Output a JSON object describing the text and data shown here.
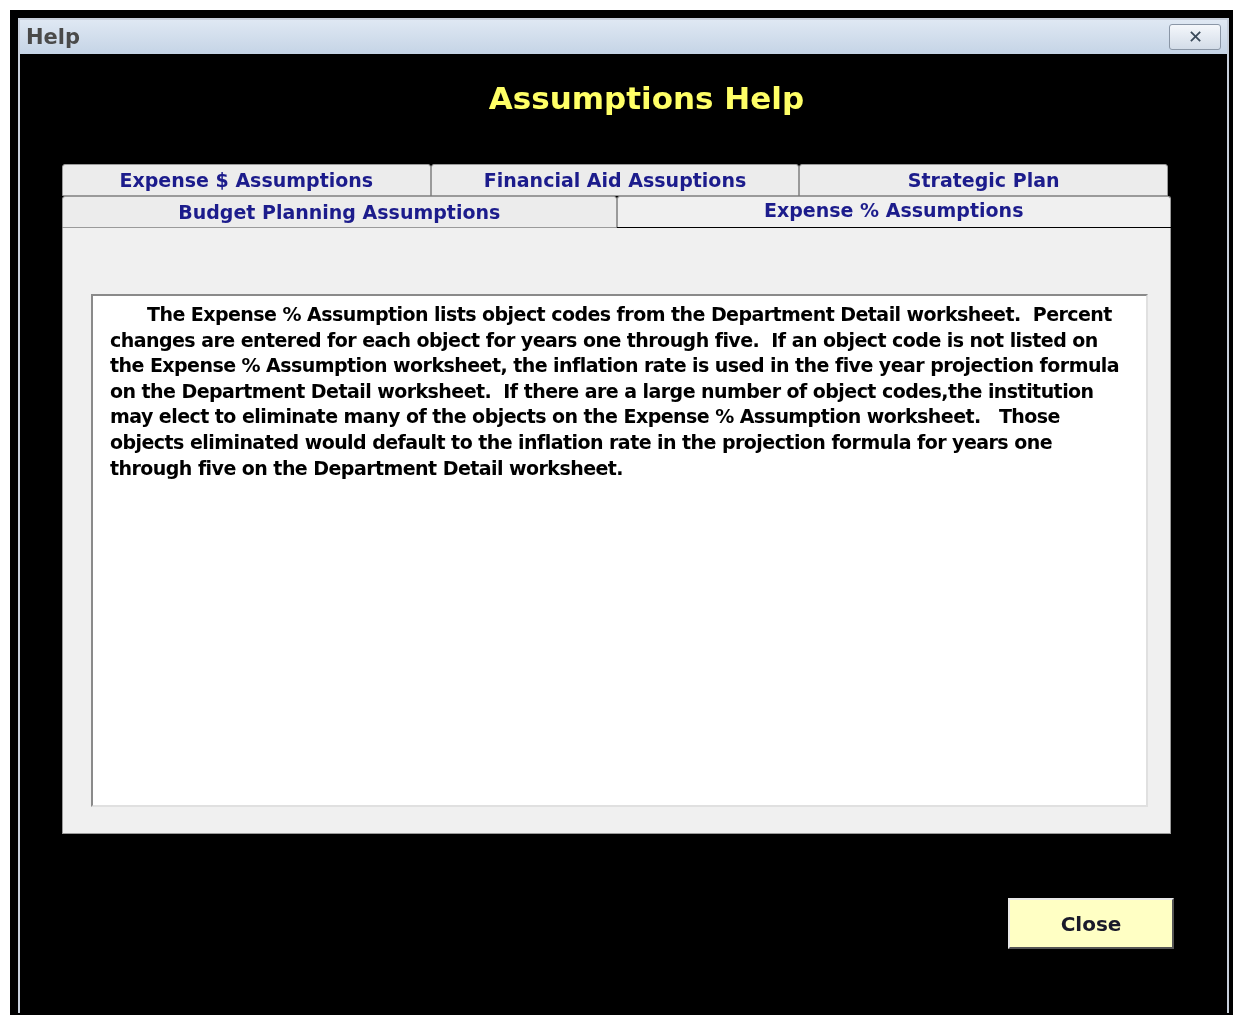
{
  "window": {
    "title": "Help",
    "close_symbol": "✕"
  },
  "heading": "Assumptions Help",
  "tab_rows": [
    [
      {
        "label": "Expense $ Assumptions",
        "selected": false
      },
      {
        "label": "Financial Aid Assuptions",
        "selected": false
      },
      {
        "label": "Strategic Plan",
        "selected": false
      }
    ],
    [
      {
        "label": "Budget Planning Assumptions",
        "selected": false
      },
      {
        "label": "Expense % Assumptions",
        "selected": true
      }
    ]
  ],
  "help_text": "The Expense % Assumption lists object codes from the Department Detail worksheet.  Percent changes are entered for each object for years one through five.  If an object code is not listed on the Expense % Assumption worksheet, the inflation rate is used in the five year projection formula on the Department Detail worksheet.  If there are a large number of object codes,the institution may elect to eliminate many of the objects on the Expense % Assumption worksheet.   Those objects eliminated would default to the inflation rate in the projection formula for years one through five on the Department Detail worksheet.",
  "buttons": [
    {
      "label": "Close"
    }
  ]
}
